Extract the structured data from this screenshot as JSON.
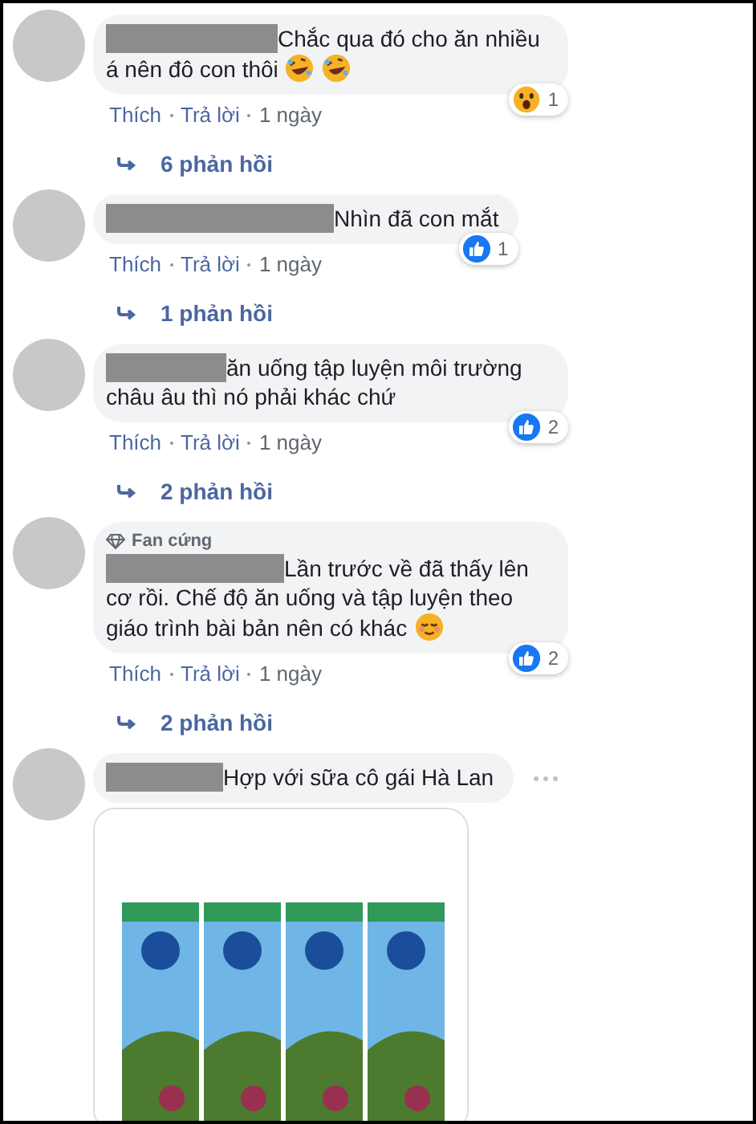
{
  "comments": [
    {
      "name_redacted": true,
      "text": "Chắc qua đó cho ăn nhiều á nên đô con thôi",
      "trailing_emoji": [
        {
          "kind": "rofl"
        },
        {
          "kind": "rofl"
        }
      ],
      "reaction": {
        "kind": "wow",
        "count": "1"
      },
      "actions": [
        "Thích",
        "Trả lời"
      ],
      "time": "1 ngày",
      "replies": "6 phản hồi"
    },
    {
      "name_redacted": true,
      "text": "Nhìn đã con mắt",
      "reaction": {
        "kind": "like",
        "count": "1"
      },
      "actions": [
        "Thích",
        "Trả lời"
      ],
      "time": "1 ngày",
      "replies": "1 phản hồi"
    },
    {
      "name_redacted": true,
      "text": "ăn uống tập luyện môi trường châu âu thì nó phải khác chứ",
      "reaction": {
        "kind": "like",
        "count": "2"
      },
      "actions": [
        "Thích",
        "Trả lời"
      ],
      "time": "1 ngày",
      "replies": "2 phản hồi"
    },
    {
      "badge": "Fan cứng",
      "name_redacted": true,
      "text": "Lần trước về đã thấy lên cơ rồi. Chế độ ăn uống và tập luyện theo giáo trình bài bản nên có khác",
      "trailing_emoji": [
        {
          "kind": "relieved"
        }
      ],
      "reaction": {
        "kind": "like",
        "count": "2"
      },
      "actions": [
        "Thích",
        "Trả lời"
      ],
      "time": "1 ngày",
      "replies": "2 phản hồi"
    },
    {
      "name_redacted": true,
      "text": "Hợp với sữa cô gái Hà Lan",
      "has_menu": true
    }
  ]
}
